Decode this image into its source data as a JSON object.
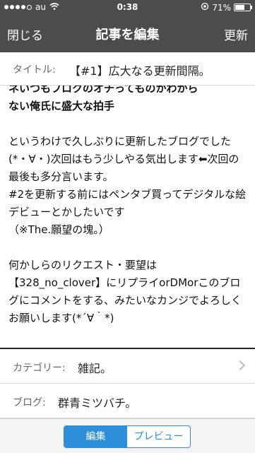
{
  "status_bar": {
    "carrier": "au",
    "time": "0:38",
    "battery": "71%",
    "battery_level": 0.71
  },
  "nav": {
    "close_label": "閉じる",
    "title": "記事を編集",
    "update_label": "更新"
  },
  "title_field": {
    "label": "タイトル:",
    "value": "【#1】広大なる更新間隔。"
  },
  "body": {
    "partial_top_line": "ネいつもフロクのオチってものかわから",
    "heading_line": "ない俺氏に盛大な拍手",
    "paragraph1": "というわけで久しぶりに更新したブログでした(*・∀・)次回はもう少しやる気出します⬅次回の最後も多分言います。\n#2を更新する前にはペンタブ買ってデジタルな絵デビューとかしたいです\n（※The.願望の塊。）",
    "paragraph2": "何かしらのリクエスト・要望は【328_no_clover】にリプライorDMorこのブログにコメントをする、みたいなカンジでよろしくお願いします(*´∀｀*)"
  },
  "category": {
    "label": "カテゴリー:",
    "value": "雑記。"
  },
  "blog": {
    "label": "ブログ:",
    "value": "群青ミツバチ。"
  },
  "tabs": {
    "edit_label": "編集",
    "preview_label": "プレビュー"
  }
}
